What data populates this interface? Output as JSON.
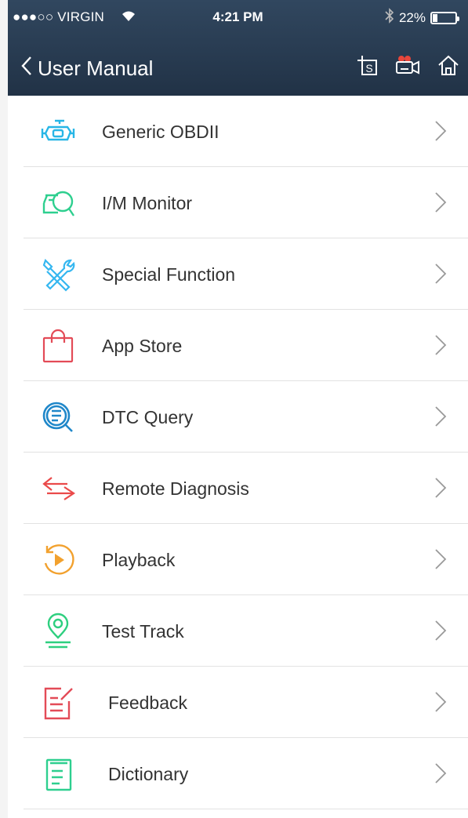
{
  "status_bar": {
    "carrier": "●●●○○ VIRGIN",
    "time": "4:21 PM",
    "battery_text": "22%",
    "battery_level": 0.22
  },
  "nav": {
    "back_label": "User Manual",
    "icons": [
      "screenshot-s-icon",
      "record-video-icon",
      "home-icon"
    ]
  },
  "menu": {
    "items": [
      {
        "label": "Generic OBDII",
        "icon": "engine-icon",
        "color": "#27b6e6"
      },
      {
        "label": "I/M Monitor",
        "icon": "monitor-search-icon",
        "color": "#2ecf8f"
      },
      {
        "label": "Special Function",
        "icon": "wrench-screwdriver-icon",
        "color": "#35b7f0"
      },
      {
        "label": "App Store",
        "icon": "shopping-bag-icon",
        "color": "#e34b57"
      },
      {
        "label": "DTC Query",
        "icon": "document-search-icon",
        "color": "#1f87c9"
      },
      {
        "label": "Remote Diagnosis",
        "icon": "swap-arrows-icon",
        "color": "#ea4a4a"
      },
      {
        "label": "Playback",
        "icon": "playback-icon",
        "color": "#f2a12e"
      },
      {
        "label": "Test Track",
        "icon": "location-pin-icon",
        "color": "#2ecf7f"
      },
      {
        "label": "Feedback",
        "icon": "feedback-edit-icon",
        "color": "#e34b57"
      },
      {
        "label": "Dictionary",
        "icon": "dictionary-book-icon",
        "color": "#2ecf8f"
      }
    ]
  }
}
